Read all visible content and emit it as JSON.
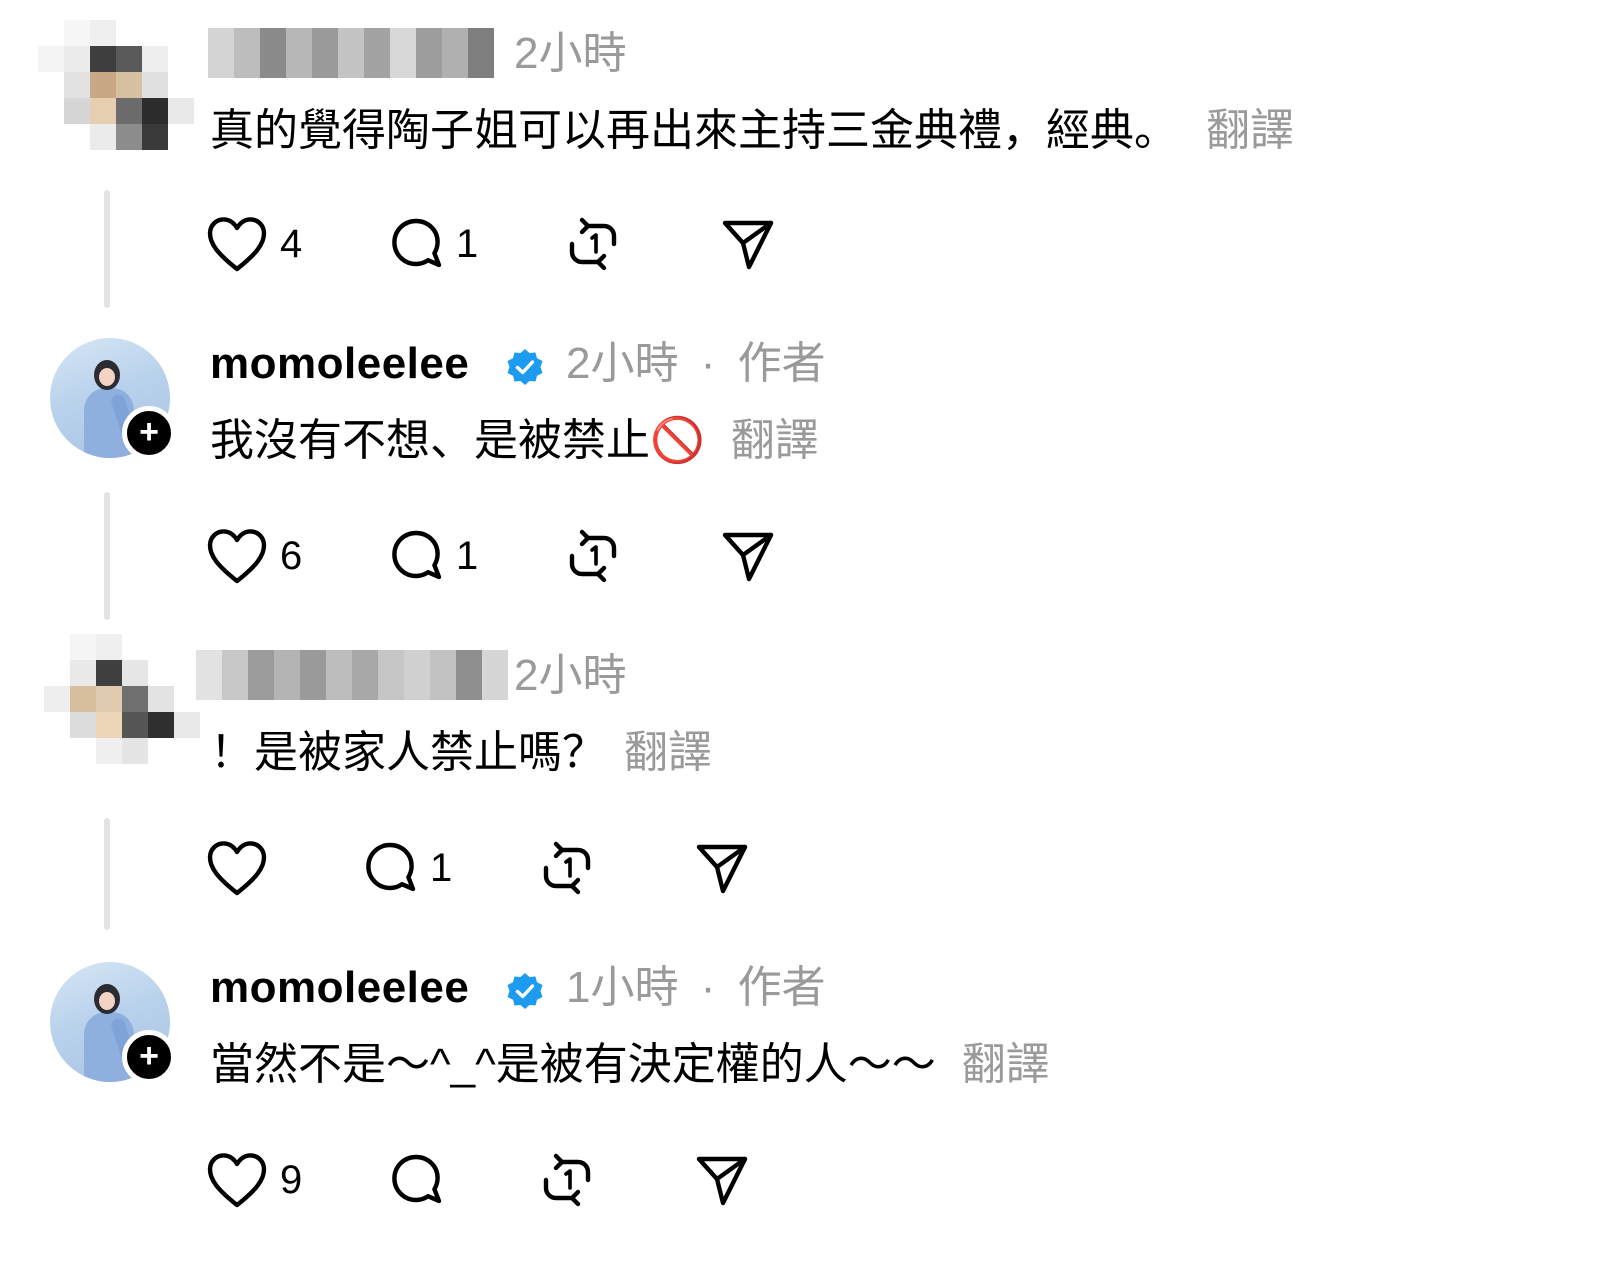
{
  "comments": [
    {
      "username": "",
      "time": "2小時",
      "text": "真的覺得陶子姐可以再出來主持三金典禮，經典。",
      "translate": "翻譯",
      "likes": "4",
      "replies": "1"
    },
    {
      "username": "momoleelee",
      "time": "2小時",
      "separator": "·",
      "author_badge": "作者",
      "text": "我沒有不想、是被禁止🚫",
      "translate": "翻譯",
      "likes": "6",
      "replies": "1"
    },
    {
      "username": "",
      "time": "2小時",
      "text": "！是被家人禁止嗎？",
      "translate": "翻譯",
      "likes": "",
      "replies": "1"
    },
    {
      "username": "momoleelee",
      "time": "1小時",
      "separator": "·",
      "author_badge": "作者",
      "text": "當然不是～^_^是被有決定權的人～～",
      "translate": "翻譯",
      "likes": "9",
      "replies": ""
    }
  ],
  "icons": {
    "like": "heart-icon",
    "reply": "comment-bubble-icon",
    "repost": "repost-icon",
    "share": "send-icon",
    "verified": "verified-badge-icon",
    "follow": "plus-icon"
  },
  "colors": {
    "verified": "#1d9bf0",
    "muted_text": "#9a9a9a",
    "thread_line": "#e3e3e3"
  }
}
